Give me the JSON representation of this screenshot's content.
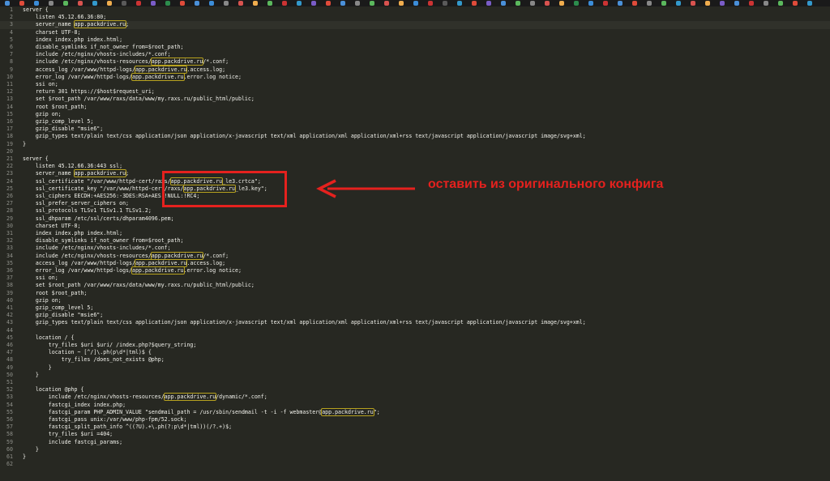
{
  "tab_icon_colors": [
    "#4a90d9",
    "#e04b3a",
    "#3c8dd9",
    "#888888",
    "#5bb85d",
    "#d9534f",
    "#3399cc",
    "#f0ad4e",
    "#5a5a5a",
    "#cc3333",
    "#7a5cc7",
    "#2c8c4c",
    "#e04b3a",
    "#4a90d9",
    "#3c8dd9",
    "#888888",
    "#d9534f",
    "#f0ad4e",
    "#5bb85d",
    "#cc3333",
    "#3399cc",
    "#7a5cc7",
    "#e04b3a",
    "#4a90d9",
    "#888888",
    "#5bb85d",
    "#d9534f",
    "#f0ad4e",
    "#3c8dd9",
    "#cc3333",
    "#5a5a5a",
    "#3399cc",
    "#e04b3a",
    "#7a5cc7",
    "#4a90d9",
    "#5bb85d",
    "#888888",
    "#d9534f",
    "#f0ad4e",
    "#2c8c4c",
    "#3c8dd9",
    "#cc3333",
    "#4a90d9",
    "#e04b3a",
    "#888888",
    "#5bb85d",
    "#3399cc",
    "#d9534f",
    "#f0ad4e",
    "#7a5cc7",
    "#4a90d9",
    "#cc3333",
    "#888888",
    "#5bb85d",
    "#e04b3a",
    "#3399cc"
  ],
  "editor": {
    "current_line": 3,
    "highlight_term": "app.packdrive.ru",
    "lines": [
      {
        "n": "1",
        "text": "server {"
      },
      {
        "n": "2",
        "text": "    listen 45.12.66.36:80;"
      },
      {
        "n": "3",
        "text": "    server_name app.packdrive.ru;"
      },
      {
        "n": "4",
        "text": "    charset UTF-8;"
      },
      {
        "n": "5",
        "text": "    index index.php index.html;"
      },
      {
        "n": "6",
        "text": "    disable_symlinks if_not_owner from=$root_path;"
      },
      {
        "n": "7",
        "text": "    include /etc/nginx/vhosts-includes/*.conf;"
      },
      {
        "n": "8",
        "text": "    include /etc/nginx/vhosts-resources/app.packdrive.ru/*.conf;"
      },
      {
        "n": "9",
        "text": "    access_log /var/www/httpd-logs/app.packdrive.ru.access.log;"
      },
      {
        "n": "10",
        "text": "    error_log /var/www/httpd-logs/app.packdrive.ru.error.log notice;"
      },
      {
        "n": "11",
        "text": "    ssi on;"
      },
      {
        "n": "12",
        "text": "    return 301 https://$host$request_uri;"
      },
      {
        "n": "13",
        "text": "    set $root_path /var/www/raxs/data/www/my.raxs.ru/public_html/public;"
      },
      {
        "n": "14",
        "text": "    root $root_path;"
      },
      {
        "n": "15",
        "text": "    gzip on;"
      },
      {
        "n": "16",
        "text": "    gzip_comp_level 5;"
      },
      {
        "n": "17",
        "text": "    gzip_disable \"msie6\";"
      },
      {
        "n": "18",
        "text": "    gzip_types text/plain text/css application/json application/x-javascript text/xml application/xml application/xml+rss text/javascript application/javascript image/svg+xml;"
      },
      {
        "n": "19",
        "text": "}"
      },
      {
        "n": "20",
        "text": ""
      },
      {
        "n": "21",
        "text": "server {"
      },
      {
        "n": "22",
        "text": "    listen 45.12.66.36:443 ssl;"
      },
      {
        "n": "23",
        "text": "    server_name app.packdrive.ru;"
      },
      {
        "n": "24",
        "text": "    ssl_certificate \"/var/www/httpd-cert/raxs/app.packdrive.ru_le3.crtca\";"
      },
      {
        "n": "25",
        "text": "    ssl_certificate_key \"/var/www/httpd-cert/raxs/app.packdrive.ru_le3.key\";"
      },
      {
        "n": "26",
        "text": "    ssl_ciphers EECDH:+AES256:-3DES:RSA+AES:!NULL:!RC4;"
      },
      {
        "n": "27",
        "text": "    ssl_prefer_server_ciphers on;"
      },
      {
        "n": "28",
        "text": "    ssl_protocols TLSv1 TLSv1.1 TLSv1.2;"
      },
      {
        "n": "29",
        "text": "    ssl_dhparam /etc/ssl/certs/dhparam4096.pem;"
      },
      {
        "n": "30",
        "text": "    charset UTF-8;"
      },
      {
        "n": "31",
        "text": "    index index.php index.html;"
      },
      {
        "n": "32",
        "text": "    disable_symlinks if_not_owner from=$root_path;"
      },
      {
        "n": "33",
        "text": "    include /etc/nginx/vhosts-includes/*.conf;"
      },
      {
        "n": "34",
        "text": "    include /etc/nginx/vhosts-resources/app.packdrive.ru/*.conf;"
      },
      {
        "n": "35",
        "text": "    access_log /var/www/httpd-logs/app.packdrive.ru.access.log;"
      },
      {
        "n": "36",
        "text": "    error_log /var/www/httpd-logs/app.packdrive.ru.error.log notice;"
      },
      {
        "n": "37",
        "text": "    ssi on;"
      },
      {
        "n": "38",
        "text": "    set $root_path /var/www/raxs/data/www/my.raxs.ru/public_html/public;"
      },
      {
        "n": "39",
        "text": "    root $root_path;"
      },
      {
        "n": "40",
        "text": "    gzip on;"
      },
      {
        "n": "41",
        "text": "    gzip_comp_level 5;"
      },
      {
        "n": "42",
        "text": "    gzip_disable \"msie6\";"
      },
      {
        "n": "43",
        "text": "    gzip_types text/plain text/css application/json application/x-javascript text/xml application/xml application/xml+rss text/javascript application/javascript image/svg+xml;"
      },
      {
        "n": "44",
        "text": ""
      },
      {
        "n": "45",
        "text": "    location / {"
      },
      {
        "n": "46",
        "text": "        try_files $uri $uri/ /index.php?$query_string;"
      },
      {
        "n": "47",
        "text": "        location ~ [^/]\\.ph(p\\d*|tml)$ {"
      },
      {
        "n": "48",
        "text": "            try_files /does_not_exists @php;"
      },
      {
        "n": "49",
        "text": "        }"
      },
      {
        "n": "50",
        "text": "    }"
      },
      {
        "n": "51",
        "text": ""
      },
      {
        "n": "52",
        "text": "    location @php {"
      },
      {
        "n": "53",
        "text": "        include /etc/nginx/vhosts-resources/app.packdrive.ru/dynamic/*.conf;"
      },
      {
        "n": "54",
        "text": "        fastcgi_index index.php;"
      },
      {
        "n": "55",
        "text": "        fastcgi_param PHP_ADMIN_VALUE \"sendmail_path = /usr/sbin/sendmail -t -i -f webmaster@app.packdrive.ru\";"
      },
      {
        "n": "56",
        "text": "        fastcgi_pass unix:/var/www/php-fpm/52.sock;"
      },
      {
        "n": "57",
        "text": "        fastcgi_split_path_info ^((?U).+\\.ph(?:p\\d*|tml))(/?.+)$;"
      },
      {
        "n": "58",
        "text": "        try_files $uri =404;"
      },
      {
        "n": "59",
        "text": "        include fastcgi_params;"
      },
      {
        "n": "60",
        "text": "    }"
      },
      {
        "n": "61",
        "text": "}"
      },
      {
        "n": "62",
        "text": ""
      }
    ]
  },
  "annotation": {
    "text": "оставить из  оригинального конфига",
    "color": "#e5211e"
  }
}
